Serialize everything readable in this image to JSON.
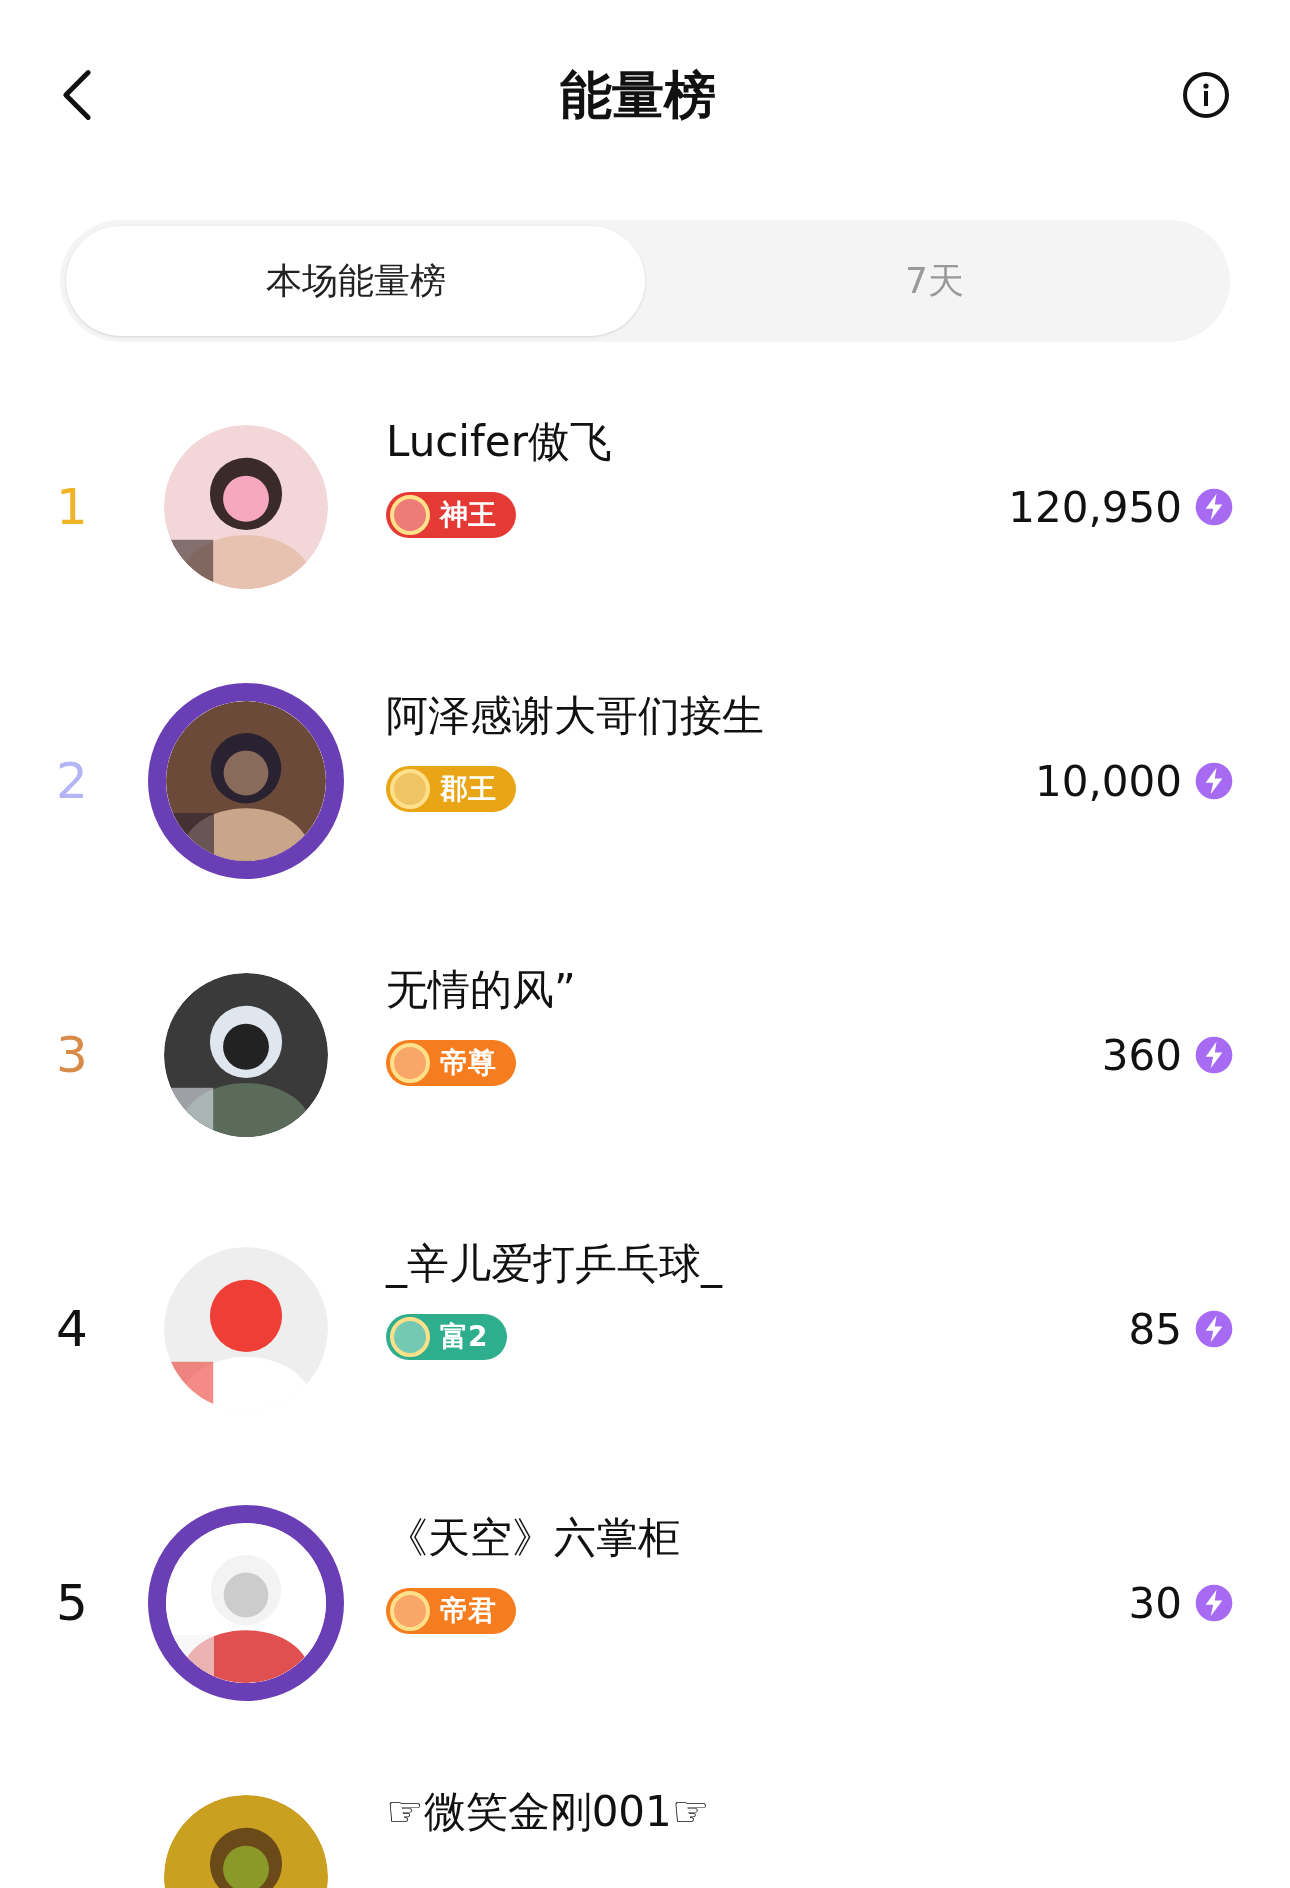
{
  "header": {
    "title": "能量榜"
  },
  "tabs": [
    {
      "label": "本场能量榜",
      "selected": true
    },
    {
      "label": "7天",
      "selected": false
    }
  ],
  "rows": [
    {
      "rank": "1",
      "color": "#f0b429",
      "name": "Lucifer傲飞",
      "badge": {
        "label": "神王",
        "color": "#e53935"
      },
      "avatar": {
        "frame": false,
        "kind": "picture"
      },
      "score": "120,950"
    },
    {
      "rank": "2",
      "color": "#b3b5f5",
      "name": "阿泽感谢大哥们接生",
      "badge": {
        "label": "郡王",
        "color": "#e9a516"
      },
      "avatar": {
        "frame": true,
        "kind": "picture"
      },
      "score": "10,000"
    },
    {
      "rank": "3",
      "color": "#d98c4a",
      "name": "无情的风”",
      "badge": {
        "label": "帝尊",
        "color": "#f57c1f"
      },
      "avatar": {
        "frame": false,
        "kind": "picture"
      },
      "score": "360"
    },
    {
      "rank": "4",
      "color": "#111111",
      "name": "_辛儿爱打乒乓球_",
      "badge": {
        "label": "富2",
        "color": "#2fae8e"
      },
      "avatar": {
        "frame": false,
        "kind": "picture"
      },
      "score": "85"
    },
    {
      "rank": "5",
      "color": "#111111",
      "name": "《天空》六掌柜",
      "badge": {
        "label": "帝君",
        "color": "#f57c1f"
      },
      "avatar": {
        "frame": true,
        "kind": "picture"
      },
      "score": "30"
    },
    {
      "name": "☞微笑金刚001☞",
      "avatar": {
        "frame": false,
        "kind": "picture"
      }
    }
  ]
}
